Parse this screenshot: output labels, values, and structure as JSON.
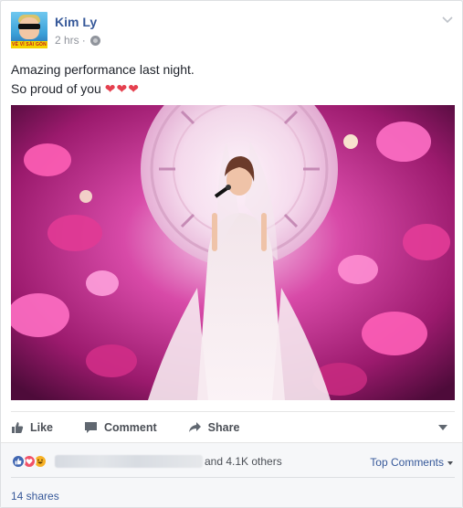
{
  "post": {
    "author": "Kim Ly",
    "timestamp": "2 hrs",
    "separator": "·",
    "privacy_icon": "globe-icon",
    "text_line1": "Amazing performance last night.",
    "text_line2": "So proud of you",
    "hearts": "❤❤❤",
    "avatar_banner": "VỀ VÌ SÀI GÒN"
  },
  "actions": {
    "like": "Like",
    "comment": "Comment",
    "share": "Share"
  },
  "footer": {
    "others": "and 4.1K others",
    "top_comments": "Top Comments",
    "shares": "14 shares"
  },
  "colors": {
    "link": "#365899",
    "like_blue": "#4267b2",
    "love_red": "#f25268",
    "haha_yellow": "#f7b125"
  }
}
